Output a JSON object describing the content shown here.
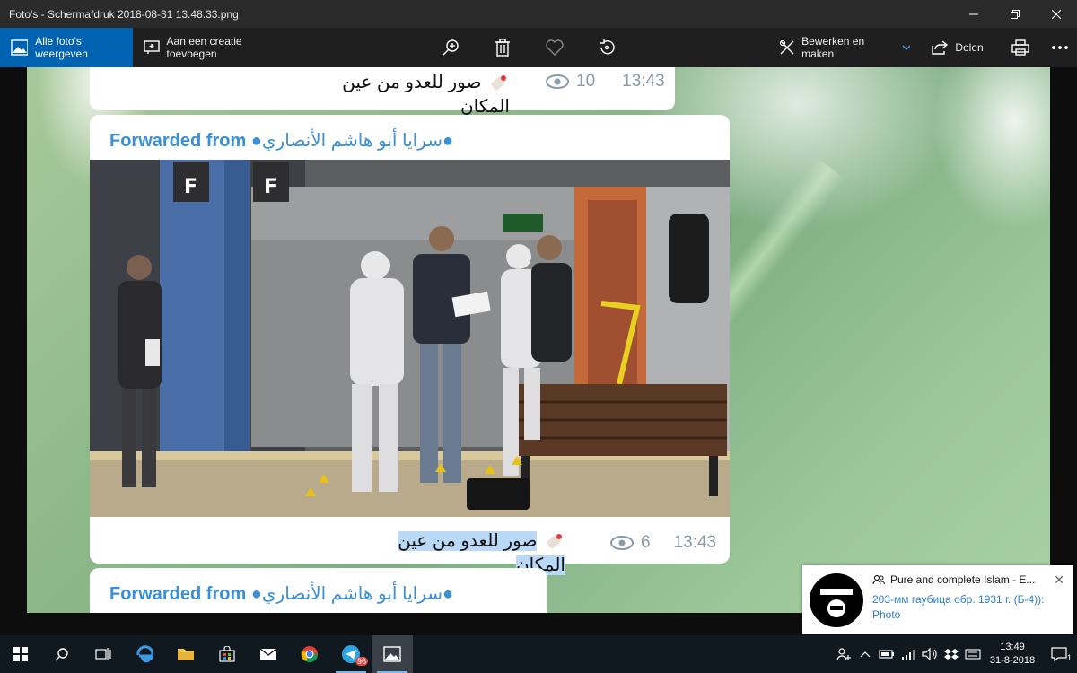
{
  "window": {
    "title": "Foto's - Schermafdruk 2018-08-31 13.48.33.png"
  },
  "toolbar": {
    "show_all_label": "Alle foto's weergeven",
    "add_creation_label": "Aan een creatie toevoegen",
    "edit_create_label": "Bewerken en maken",
    "share_label": "Delen",
    "icons": [
      "zoom-icon",
      "delete-icon",
      "favorite-icon",
      "rotate-icon",
      "print-icon",
      "more-icon"
    ]
  },
  "chat": {
    "top_message": {
      "text": "صور للعدو من عين المكان",
      "views": "10",
      "time": "13:43"
    },
    "photo_message": {
      "forwarded_label": "Forwarded from",
      "channel": "سرايا أبو هاشم الأنصاري",
      "caption": "صور للعدو من عين المكان",
      "views": "6",
      "time": "13:43",
      "platform_sign": "F"
    },
    "bottom_message": {
      "forwarded_label": "Forwarded from",
      "channel": "سرايا أبو هاشم الأنصاري"
    }
  },
  "notification": {
    "title": "Pure and complete Islam - E...",
    "body": "203-мм гаубица обр. 1931 г. (Б-4)): Photo",
    "avatar_text": "لا إله إلا الله"
  },
  "taskbar": {
    "telegram_badge": "96",
    "time": "13:49",
    "date": "31-8-2018",
    "notification_count": "1"
  },
  "colors": {
    "accent": "#0063b1",
    "link_blue": "#3a8fd6",
    "meta_gray": "#8a9aa8",
    "taskbar": "#101820"
  }
}
